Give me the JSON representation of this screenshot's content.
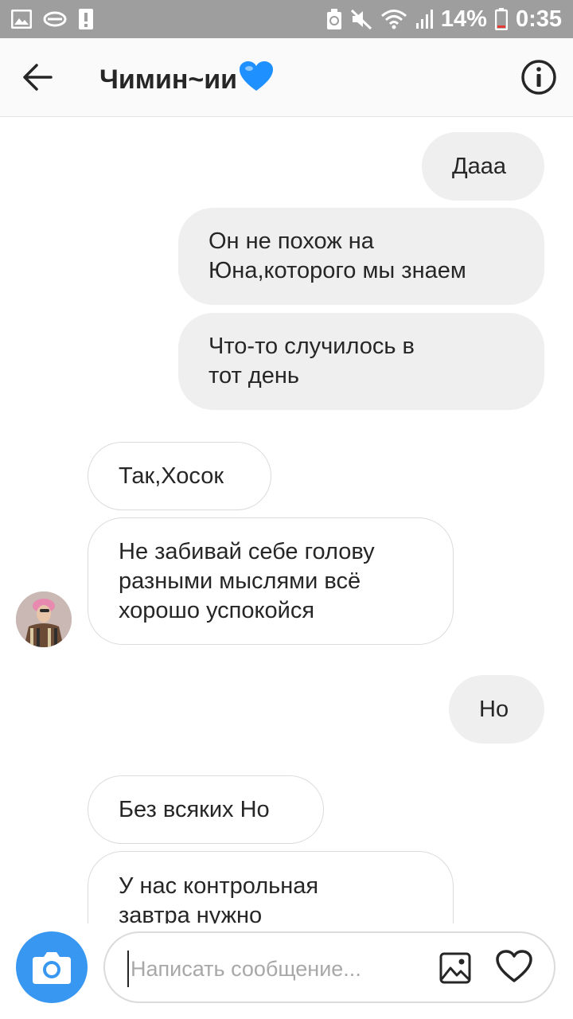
{
  "status_bar": {
    "battery_percent": "14%",
    "time": "0:35",
    "left_icons": [
      "gallery-icon",
      "cloud-sync-icon",
      "alert-icon"
    ],
    "right_icons": [
      "recycle-icon",
      "mute-icon",
      "wifi-icon",
      "signal-icon",
      "battery-icon"
    ]
  },
  "header": {
    "contact_name": "Чимин~ии",
    "emoji": "💙",
    "back_icon": "arrow-left-icon",
    "info_icon": "info-icon"
  },
  "messages": [
    {
      "direction": "outgoing",
      "text": "Дааа"
    },
    {
      "direction": "outgoing",
      "text": "Он не похож на\nЮна,которого мы знаем"
    },
    {
      "direction": "outgoing",
      "text": "Что-то случилось в\nтот день"
    },
    {
      "direction": "incoming",
      "text": "Так,Хосок"
    },
    {
      "direction": "incoming",
      "text": "Не забивай себе голову\nразными мыслями всё\nхорошо успокойся"
    },
    {
      "direction": "outgoing",
      "text": "Но"
    },
    {
      "direction": "incoming",
      "text": "Без всяких Но"
    },
    {
      "direction": "incoming",
      "text": "У нас контрольная\nзавтра нужно"
    }
  ],
  "composer": {
    "placeholder": "Написать сообщение...",
    "value": "",
    "camera_icon": "camera-icon",
    "gallery_icon": "image-icon",
    "like_icon": "heart-icon"
  },
  "colors": {
    "accent": "#3897f0",
    "outgoing_bubble": "#efefef",
    "incoming_border": "#dbdbdb",
    "status_bar": "#9e9e9e"
  }
}
